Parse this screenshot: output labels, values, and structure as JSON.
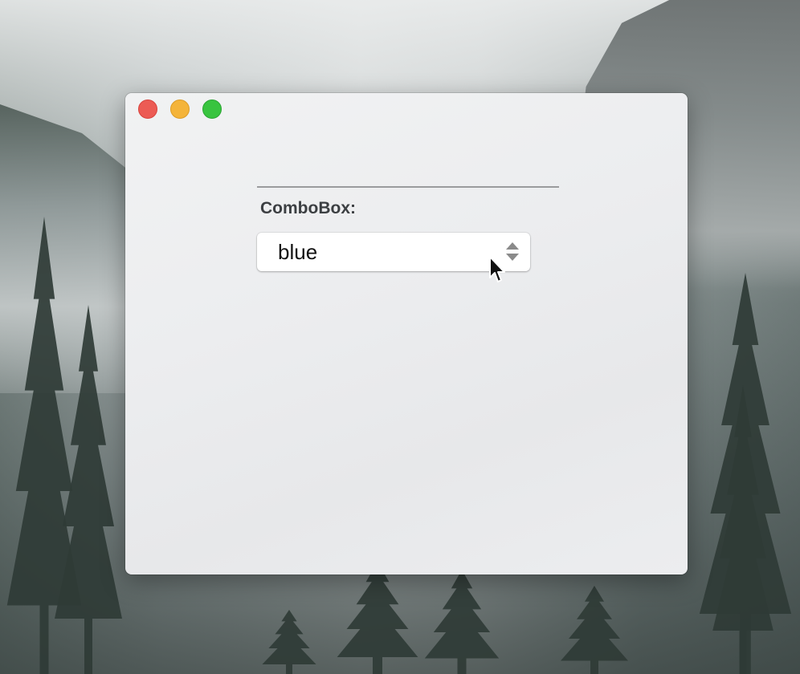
{
  "window": {
    "controls": [
      "close",
      "minimize",
      "zoom"
    ]
  },
  "combobox": {
    "label": "ComboBox:",
    "value": "blue",
    "arrow_icon": "stepper-arrows-icon"
  },
  "colors": {
    "close": "#ec5b54",
    "minimize": "#f4b43a",
    "zoom": "#38c43f"
  }
}
